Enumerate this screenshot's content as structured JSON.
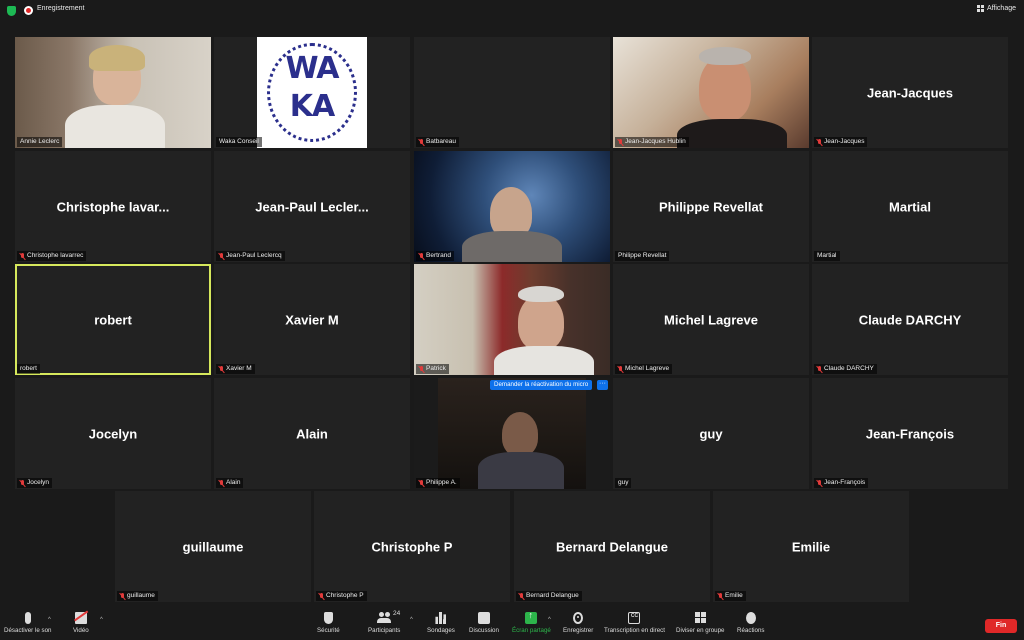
{
  "topbar": {
    "recording_label": "Enregistrement",
    "view_label": "Affichage"
  },
  "tiles": [
    {
      "name": "Annie Leclerc",
      "display": "",
      "muted": false,
      "video": "annie"
    },
    {
      "name": "Waka Conseil",
      "display": "",
      "muted": false,
      "video": "waka"
    },
    {
      "name": "Batbareau",
      "display": "",
      "muted": true,
      "video": "none"
    },
    {
      "name": "Jean-Jacques Hublin",
      "display": "",
      "muted": true,
      "video": "jjh"
    },
    {
      "name": "Jean-Jacques",
      "display": "Jean-Jacques",
      "muted": true,
      "video": "none"
    },
    {
      "name": "Christophe lavarrec",
      "display": "Christophe  lavar...",
      "muted": true,
      "video": "none"
    },
    {
      "name": "Jean-Paul Leclercq",
      "display": "Jean-Paul  Lecler...",
      "muted": true,
      "video": "none"
    },
    {
      "name": "Bertrand",
      "display": "",
      "muted": true,
      "video": "bert"
    },
    {
      "name": "Philippe Revellat",
      "display": "Philippe Revellat",
      "muted": false,
      "video": "none"
    },
    {
      "name": "Martial",
      "display": "Martial",
      "muted": false,
      "video": "none"
    },
    {
      "name": "robert",
      "display": "robert",
      "muted": false,
      "video": "none",
      "active": true
    },
    {
      "name": "Xavier M",
      "display": "Xavier M",
      "muted": true,
      "video": "none"
    },
    {
      "name": "Patrick",
      "display": "",
      "muted": true,
      "video": "patrick"
    },
    {
      "name": "Michel Lagreve",
      "display": "Michel Lagreve",
      "muted": true,
      "video": "none"
    },
    {
      "name": "Claude DARCHY",
      "display": "Claude DARCHY",
      "muted": true,
      "video": "none"
    },
    {
      "name": "Jocelyn",
      "display": "Jocelyn",
      "muted": true,
      "video": "none"
    },
    {
      "name": "Alain",
      "display": "Alain",
      "muted": true,
      "video": "none"
    },
    {
      "name": "Philippe A.",
      "display": "",
      "muted": true,
      "video": "phil"
    },
    {
      "name": "guy",
      "display": "guy",
      "muted": false,
      "video": "none"
    },
    {
      "name": "Jean-François",
      "display": "Jean-François",
      "muted": true,
      "video": "none"
    },
    {
      "name": "guillaume",
      "display": "guillaume",
      "muted": true,
      "video": "none"
    },
    {
      "name": "Christophe P",
      "display": "Christophe P",
      "muted": true,
      "video": "none"
    },
    {
      "name": "Bernard Delangue",
      "display": "Bernard Delangue",
      "muted": true,
      "video": "none"
    },
    {
      "name": "Emilie",
      "display": "Emilie",
      "muted": true,
      "video": "none"
    }
  ],
  "waka_logo": {
    "line1": "WA",
    "line2": "KA"
  },
  "unmute_request": {
    "label": "Demander la réactivation du micro",
    "more": "···"
  },
  "toolbar": {
    "mute": "Désactiver le son",
    "video": "Vidéo",
    "security": "Sécurité",
    "participants": "Participants",
    "participants_count": "24",
    "polls": "Sondages",
    "chat": "Discussion",
    "share": "Écran partagé",
    "record": "Enregistrer",
    "captions": "Transcription en direct",
    "breakout": "Diviser en groupe",
    "reactions": "Réactions",
    "end": "Fin",
    "captions_icon": "CC"
  },
  "colors": {
    "accent_active": "#d6e85c",
    "end_red": "#e02828",
    "share_green": "#2db54b",
    "blue_bar": "#0e71eb"
  }
}
